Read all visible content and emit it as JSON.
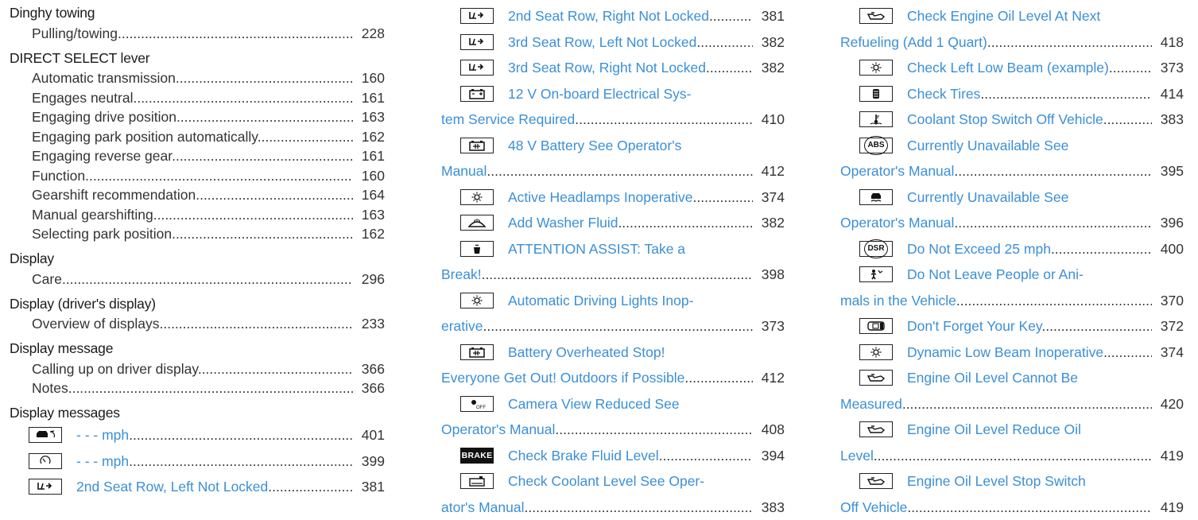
{
  "col1": {
    "sections": [
      {
        "heading": "Dinghy towing",
        "items": [
          {
            "text": "Pulling/towing",
            "page": "228"
          }
        ]
      },
      {
        "heading": "DIRECT SELECT lever",
        "items": [
          {
            "text": "Automatic transmission",
            "page": "160"
          },
          {
            "text": "Engages neutral",
            "page": "161"
          },
          {
            "text": "Engaging drive position",
            "page": "163"
          },
          {
            "text": "Engaging park position automatically",
            "page": "162"
          },
          {
            "text": "Engaging reverse gear",
            "page": "161"
          },
          {
            "text": "Function",
            "page": "160"
          },
          {
            "text": "Gearshift recommendation",
            "page": "164"
          },
          {
            "text": "Manual gearshifting",
            "page": "163"
          },
          {
            "text": "Selecting park position",
            "page": "162"
          }
        ]
      },
      {
        "heading": "Display",
        "items": [
          {
            "text": "Care",
            "page": "296"
          }
        ]
      },
      {
        "heading": "Display (driver's display)",
        "items": [
          {
            "text": "Overview of displays",
            "page": "233"
          }
        ]
      },
      {
        "heading": "Display message",
        "items": [
          {
            "text": "Calling up on driver display",
            "page": "366"
          },
          {
            "text": "Notes",
            "page": "366"
          }
        ]
      }
    ],
    "messages_heading": "Display messages",
    "messages": [
      {
        "icon": "speed-limiter-icon",
        "text": "- - - mph",
        "page": "401"
      },
      {
        "icon": "speedometer-icon",
        "text": "- - - mph",
        "page": "399"
      },
      {
        "icon": "seat-icon",
        "text": "2nd Seat Row, Left Not Locked",
        "page": "381"
      }
    ]
  },
  "col2": {
    "messages": [
      {
        "icon": "seat-icon",
        "lines": [
          "2nd Seat Row, Right Not Locked"
        ],
        "page": "381"
      },
      {
        "icon": "seat-icon",
        "lines": [
          "3rd Seat Row, Left Not Locked"
        ],
        "page": "382"
      },
      {
        "icon": "seat-icon",
        "lines": [
          "3rd Seat Row, Right Not Locked"
        ],
        "page": "382"
      },
      {
        "icon": "battery-icon",
        "lines": [
          "12 V On-board Electrical Sys-",
          "tem Service Required"
        ],
        "page": "410"
      },
      {
        "icon": "battery-48v-icon",
        "lines": [
          "48 V Battery See Operator's",
          "Manual"
        ],
        "page": "412"
      },
      {
        "icon": "headlamp-icon",
        "lines": [
          "Active Headlamps Inoperative"
        ],
        "page": "374"
      },
      {
        "icon": "washer-fluid-icon",
        "lines": [
          "Add Washer Fluid"
        ],
        "page": "382"
      },
      {
        "icon": "coffee-cup-icon",
        "lines": [
          "ATTENTION ASSIST: Take a",
          "Break!"
        ],
        "page": "398"
      },
      {
        "icon": "headlamp-icon",
        "lines": [
          "Automatic Driving Lights Inop-",
          "erative"
        ],
        "page": "373"
      },
      {
        "icon": "battery-48v-icon",
        "lines": [
          "Battery Overheated Stop!",
          "Everyone Get Out! Outdoors if Possible"
        ],
        "page": "412"
      },
      {
        "icon": "camera-off-icon",
        "lines": [
          "Camera View Reduced See",
          "Operator's Manual"
        ],
        "page": "408"
      },
      {
        "icon": "brake-icon",
        "icon_text": "BRAKE",
        "lines": [
          "Check Brake Fluid Level"
        ],
        "page": "394"
      },
      {
        "icon": "coolant-icon",
        "lines": [
          "Check Coolant Level See Oper-",
          "ator's Manual"
        ],
        "page": "383"
      }
    ]
  },
  "col3": {
    "messages": [
      {
        "icon": "oil-can-icon",
        "lines": [
          "Check Engine Oil Level At Next",
          "Refueling (Add 1 Quart)"
        ],
        "page": "418"
      },
      {
        "icon": "headlamp-icon",
        "lines": [
          "Check Left Low Beam (example)"
        ],
        "page": "373"
      },
      {
        "icon": "tire-icon",
        "lines": [
          "Check Tires"
        ],
        "page": "414"
      },
      {
        "icon": "coolant-temp-icon",
        "lines": [
          "Coolant Stop Switch Off Vehicle"
        ],
        "page": "383"
      },
      {
        "icon": "abs-icon",
        "icon_text": "ABS",
        "lines": [
          "Currently Unavailable See",
          "Operator's Manual"
        ],
        "page": "395"
      },
      {
        "icon": "esp-icon",
        "lines": [
          "Currently Unavailable See",
          "Operator's Manual"
        ],
        "page": "396"
      },
      {
        "icon": "dsr-icon",
        "icon_text": "DSR",
        "lines": [
          "Do Not Exceed 25 mph"
        ],
        "page": "400"
      },
      {
        "icon": "child-icon",
        "lines": [
          "Do Not Leave People or Ani-",
          "mals in the Vehicle"
        ],
        "page": "370"
      },
      {
        "icon": "key-icon",
        "lines": [
          "Don't Forget Your Key"
        ],
        "page": "372"
      },
      {
        "icon": "headlamp-icon",
        "lines": [
          "Dynamic Low Beam Inoperative"
        ],
        "page": "374"
      },
      {
        "icon": "oil-can-icon",
        "lines": [
          "Engine Oil Level Cannot Be",
          "Measured"
        ],
        "page": "420"
      },
      {
        "icon": "oil-can-icon",
        "lines": [
          "Engine Oil Level Reduce Oil",
          "Level"
        ],
        "page": "419"
      },
      {
        "icon": "oil-can-icon",
        "lines": [
          "Engine Oil Level Stop Switch",
          "Off Vehicle"
        ],
        "page": "419"
      }
    ]
  },
  "colors": {
    "link": "#3b8fd6",
    "text": "#1a1a1a",
    "dots": "#333333"
  }
}
